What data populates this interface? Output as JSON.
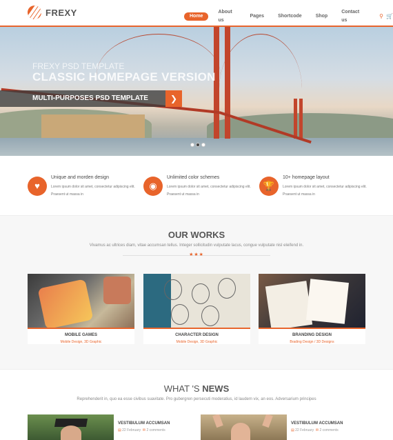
{
  "brand": {
    "name": "FREXY"
  },
  "nav": {
    "items": [
      "Home",
      "About us",
      "Pages",
      "Shortcode",
      "Shop",
      "Contact us"
    ],
    "active": "Home",
    "search_icon": "search-icon",
    "cart_icon": "cart-icon"
  },
  "hero": {
    "subtitle": "FREXY PSD TEMPLATE",
    "title": "CLASSIC HOMEPAGE VERSION",
    "banner": "MULTI-PURPOSES PSD TEMPLATE",
    "slides": 3,
    "active_slide": 1
  },
  "features": [
    {
      "icon": "heart-icon",
      "title": "Unique and morden design",
      "desc": "Lorem ipsum dolor sit amet, consectetur adipiscing elit. Praesent ut massa in"
    },
    {
      "icon": "camera-icon",
      "title": "Unlimited color schemes",
      "desc": "Lorem ipsum dolor sit amet, consectetur adipiscing elit. Praesent ut massa in"
    },
    {
      "icon": "trophy-icon",
      "title": "10+ homepage layout",
      "desc": "Lorem ipsum dolor sit amet, consectetur adipiscing elit. Praesent ut massa in"
    }
  ],
  "works": {
    "title": "OUR WORKS",
    "subtitle": "Vivamus ac ultrices diam, vitae accumsan tellus. Integer sollicitudin vulputate lacus, congue vulputate nisl eleifend in.",
    "stars": "★★★",
    "items": [
      {
        "title": "MOBILE GAMES",
        "sub": "Mobile Design, 3D Graphic"
      },
      {
        "title": "CHARACTER DESIGN",
        "sub": "Mobile Design, 3D Graphic"
      },
      {
        "title": "BRANDING DESIGN",
        "sub": "Brading Design / 3D Designs"
      }
    ]
  },
  "news": {
    "title_light": "WHAT 'S",
    "title_bold": "NEWS",
    "subtitle": "Reprehenderit in, quo ea esse civibus suavitate. Pro gubergren persecuti moderatius, id laudem vix, an eos. Adversarium principes",
    "items": [
      {
        "title": "VESTIBULUM ACCUMSAN",
        "date": "22 February",
        "comments": "2 comments"
      },
      {
        "title": "VESTIBULUM ACCUMSAN",
        "date": "22 February",
        "comments": "2 comments"
      }
    ]
  },
  "colors": {
    "accent": "#e8642b"
  }
}
